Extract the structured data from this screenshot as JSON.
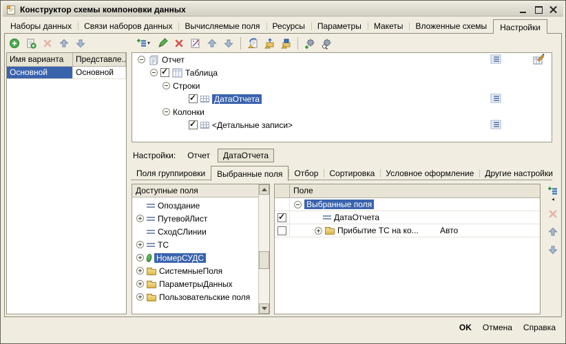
{
  "window": {
    "title": "Конструктор схемы компоновки данных",
    "controls": [
      "minimize-icon",
      "maximize-icon",
      "close-icon"
    ]
  },
  "main_tabs": {
    "items": [
      "Наборы данных",
      "Связи наборов данных",
      "Вычисляемые поля",
      "Ресурсы",
      "Параметры",
      "Макеты",
      "Вложенные схемы",
      "Настройки"
    ],
    "active": "Настройки"
  },
  "variants": {
    "toolbar_icons": [
      "add-icon",
      "copy-icon",
      "delete-icon",
      "move-up-icon",
      "move-down-icon"
    ],
    "columns": [
      "Имя варианта",
      "Представле..."
    ],
    "rows": [
      {
        "name": "Основной",
        "presentation": "Основной",
        "selected": true
      }
    ]
  },
  "structure": {
    "toolbar_icons": [
      "add-icon",
      "dropdown-caret",
      "edit-pencil-icon",
      "delete-icon",
      "wizard-icon",
      "move-up-icon",
      "move-down-icon",
      "load-settings-icon",
      "export-settings-icon",
      "save-settings-icon",
      "settings-add-icon",
      "settings-search-icon"
    ],
    "tree": [
      {
        "label": "Отчет",
        "icon": "report-icon",
        "expanded": true
      },
      {
        "label": "Таблица",
        "icon": "table-icon",
        "checked": true,
        "expanded": true
      },
      {
        "label": "Строки",
        "expanded": true
      },
      {
        "label": "ДатаОтчета",
        "icon": "grid-icon",
        "checked": true,
        "selected": true
      },
      {
        "label": "Колонки",
        "expanded": true
      },
      {
        "label": "<Детальные записи>",
        "icon": "grid-icon",
        "checked": true
      }
    ]
  },
  "settings_bar": {
    "label": "Настройки:",
    "report_button": "Отчет",
    "context_button": "ДатаОтчета"
  },
  "settings_tabs": {
    "items": [
      "Поля группировки",
      "Выбранные поля",
      "Отбор",
      "Сортировка",
      "Условное оформление",
      "Другие настройки"
    ],
    "active": "Выбранные поля"
  },
  "available_fields": {
    "header": "Доступные поля",
    "items": [
      {
        "label": "Опоздание",
        "icon": "field-icon"
      },
      {
        "label": "ПутевойЛист",
        "icon": "field-icon",
        "expandable": true
      },
      {
        "label": "СходСЛинии",
        "icon": "field-icon"
      },
      {
        "label": "ТС",
        "icon": "field-icon",
        "expandable": true
      },
      {
        "label": "НомерСУДС",
        "icon": "green-field-icon",
        "expandable": true,
        "selected": true
      },
      {
        "label": "СистемныеПоля",
        "icon": "folder-icon",
        "expandable": true
      },
      {
        "label": "ПараметрыДанных",
        "icon": "folder-icon",
        "expandable": true
      },
      {
        "label": "Пользовательские поля",
        "icon": "folder-icon",
        "expandable": true
      }
    ]
  },
  "selected_fields": {
    "column_header": "Поле",
    "group_label": "Выбранные поля",
    "rows": [
      {
        "label": "ДатаОтчета",
        "icon": "field-icon",
        "checked": true
      },
      {
        "label": "Прибытие ТС на ко...",
        "icon": "folder-icon",
        "checked": false,
        "group_type": "Авто"
      }
    ],
    "toolbar_icons": [
      "add-icon",
      "dropdown-caret",
      "delete-icon",
      "move-up-icon",
      "move-down-icon"
    ]
  },
  "footer": {
    "ok": "OK",
    "cancel": "Отмена",
    "help": "Справка"
  },
  "colors": {
    "selection": "#3a63ad",
    "window_bg": "#f0ede0",
    "accent_green": "#49b04d",
    "accent_red": "#d94f4f"
  }
}
